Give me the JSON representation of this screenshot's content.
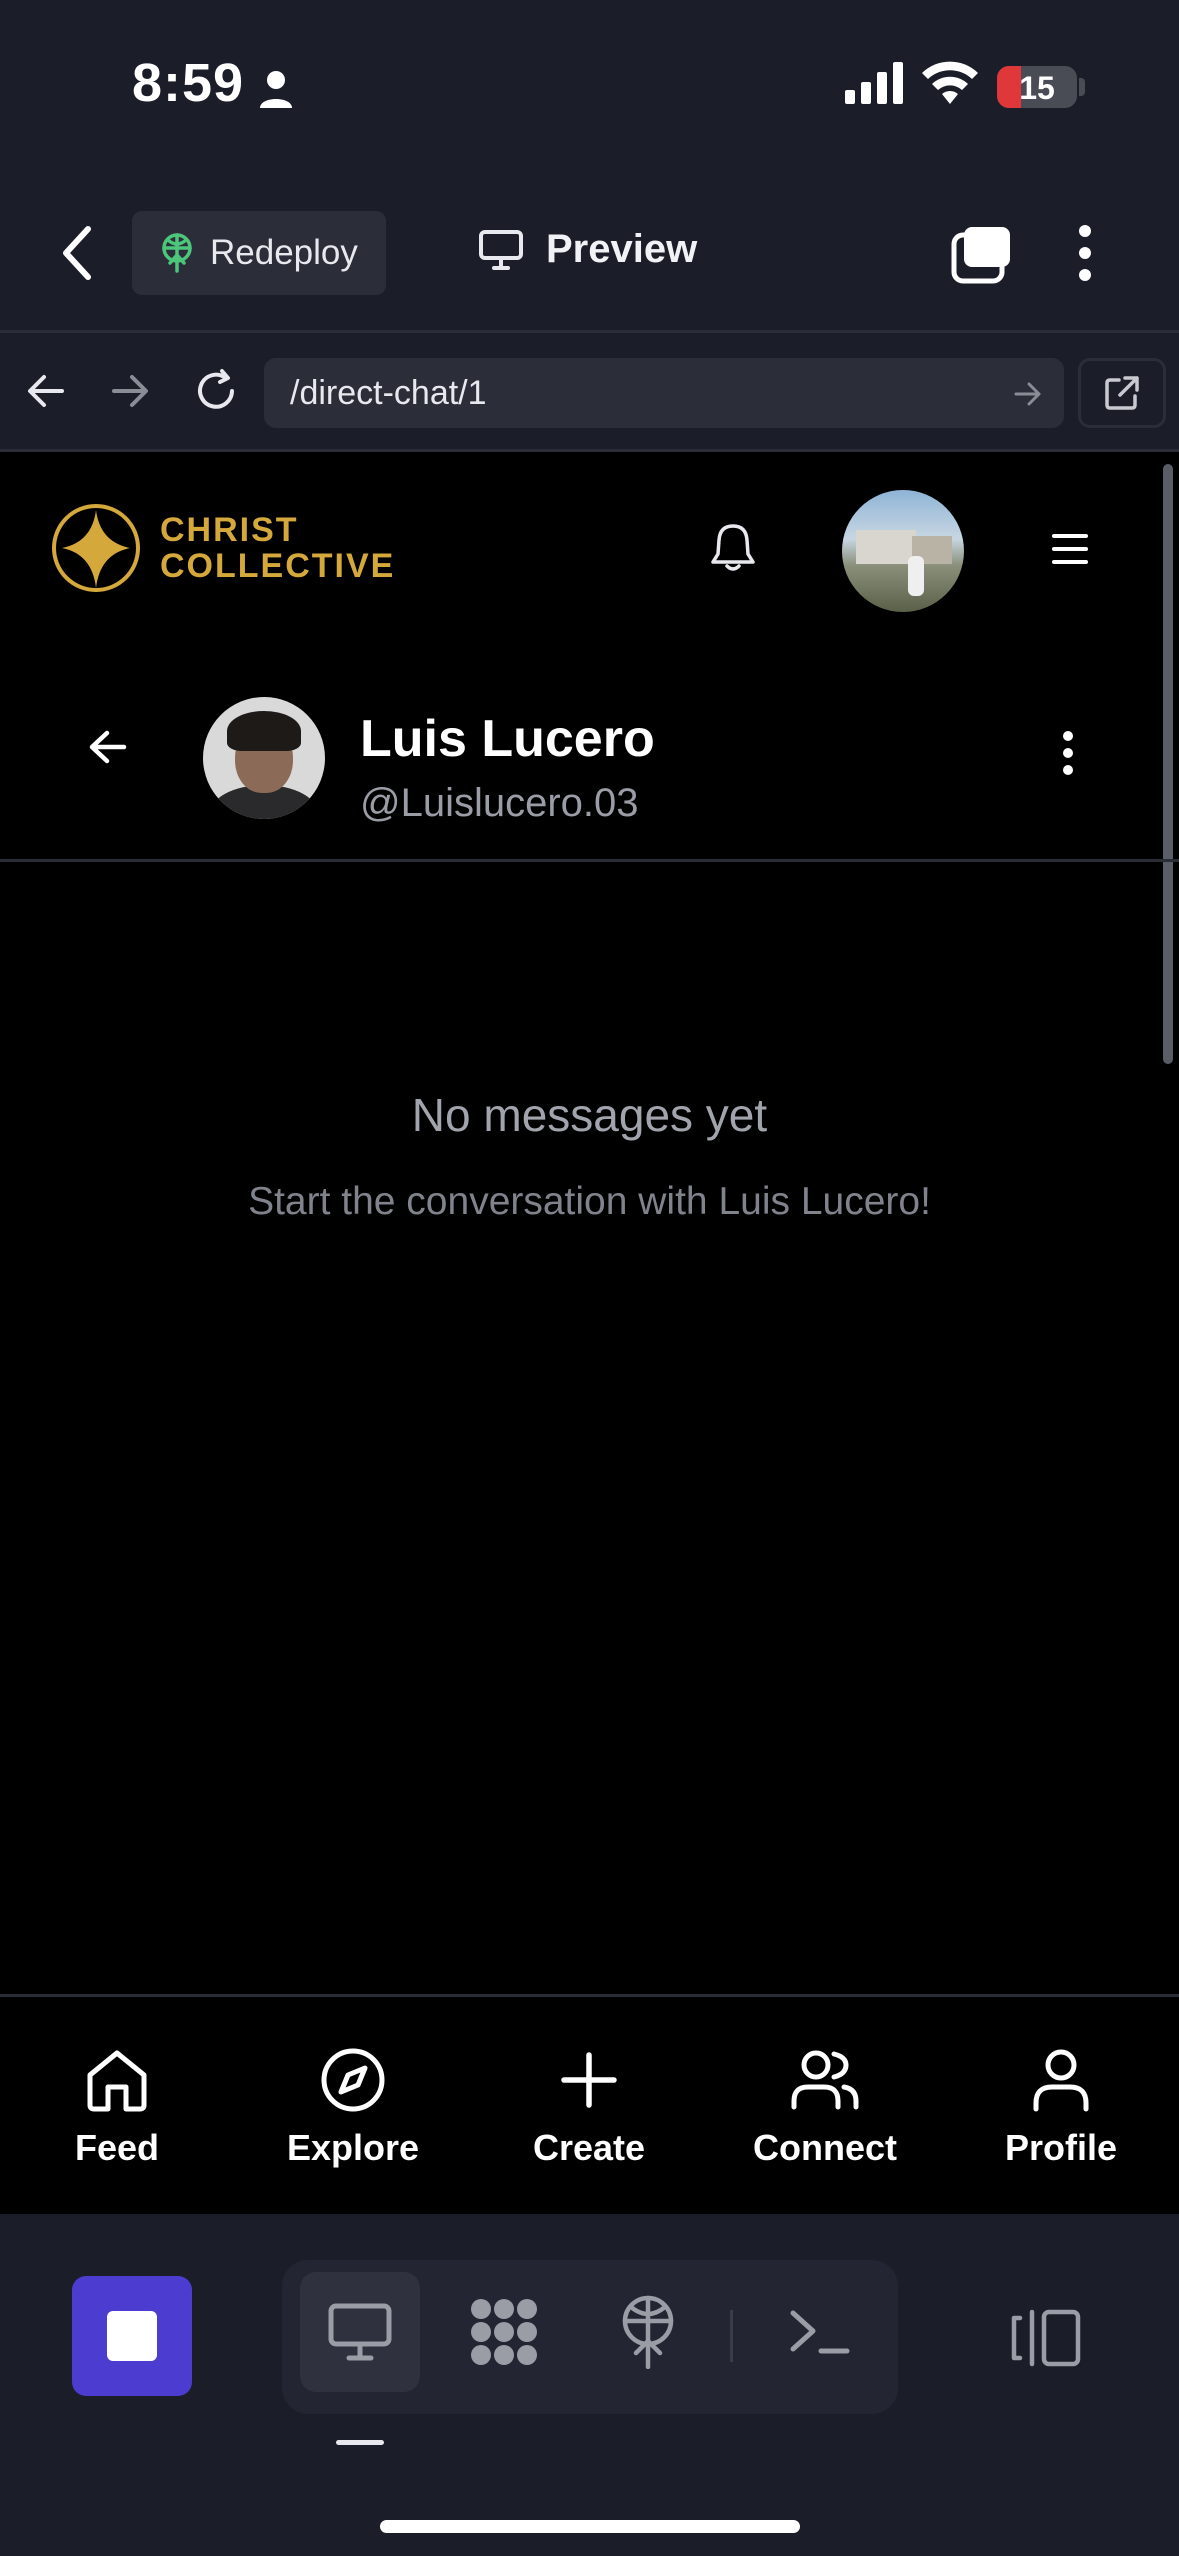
{
  "status": {
    "time": "8:59",
    "battery": "15",
    "battery_level": 0.15
  },
  "header": {
    "redeploy_label": "Redeploy",
    "preview_label": "Preview"
  },
  "urlbar": {
    "url": "/direct-chat/1"
  },
  "site": {
    "logo_line1": "CHRIST",
    "logo_line2": "COLLECTIVE"
  },
  "chat": {
    "contact_name": "Luis Lucero",
    "contact_handle": "@Luislucero.03",
    "empty_title": "No messages yet",
    "empty_subtitle": "Start the conversation with Luis Lucero!"
  },
  "bottom_nav": {
    "items": [
      {
        "label": "Feed",
        "icon": "home-icon"
      },
      {
        "label": "Explore",
        "icon": "compass-icon"
      },
      {
        "label": "Create",
        "icon": "plus-icon"
      },
      {
        "label": "Connect",
        "icon": "users-icon"
      },
      {
        "label": "Profile",
        "icon": "user-icon"
      }
    ]
  },
  "toolbar": {
    "tools": [
      "preview-icon",
      "packages-icon",
      "deploy-icon",
      "shell-icon"
    ],
    "active_tool": "preview-icon"
  },
  "colors": {
    "background": "#000000",
    "chrome": "#1b1d28",
    "accent_gold": "#d4a83a",
    "accent_purple": "#4c3ccf",
    "battery_red": "#e0383a",
    "deploy_green": "#4cc77a"
  }
}
